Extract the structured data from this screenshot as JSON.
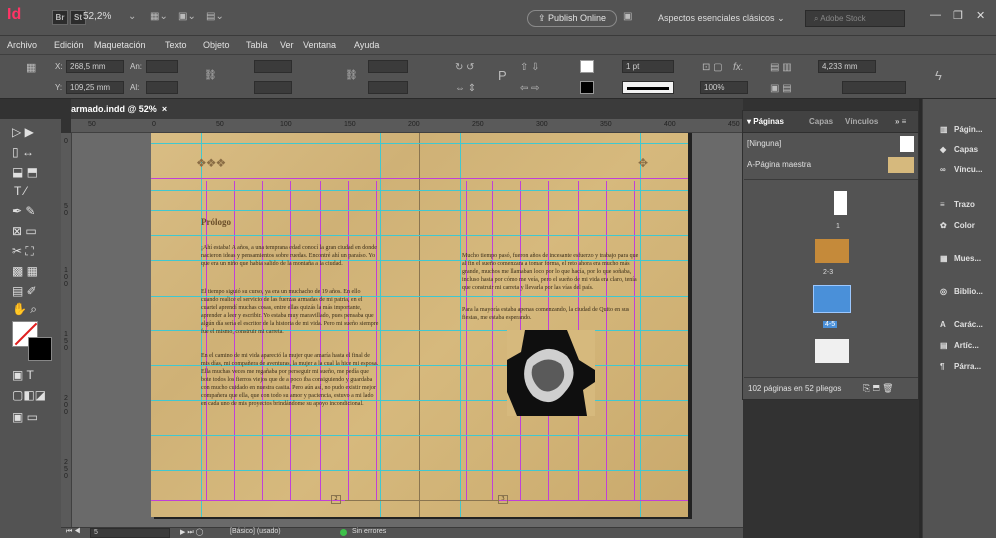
{
  "app": {
    "logo": "Id",
    "br": "Br",
    "st": "St",
    "zoom": "52,2%",
    "publish_label": "Publish Online",
    "workspace": "Aspectos esenciales clásicos",
    "stock_placeholder": "Adobe Stock"
  },
  "menu": [
    "Archivo",
    "Edición",
    "Maquetación",
    "Texto",
    "Objeto",
    "Tabla",
    "Ver",
    "Ventana",
    "Ayuda"
  ],
  "control": {
    "x_label": "X:",
    "x_value": "268,5 mm",
    "y_label": "Y:",
    "y_value": "109,25 mm",
    "w_label": "An:",
    "h_label": "Al:",
    "stroke_weight": "1 pt",
    "zoom_pct": "100%",
    "gap_value": "4,233 mm",
    "fx": "fx."
  },
  "document": {
    "tab_title": "armado.indd @ 52%",
    "close": "×"
  },
  "ruler": {
    "top": [
      "50",
      "0",
      "50",
      "100",
      "150",
      "200",
      "250",
      "300",
      "350",
      "400",
      "450"
    ],
    "left": [
      "0",
      "5\n0",
      "1\n0\n0",
      "1\n5\n0",
      "2\n0\n0",
      "2\n5\n0"
    ]
  },
  "page_left": {
    "title": "Prólogo",
    "p1": "¡Ahí estaba! A años, a una temprana edad conocí la gran ciudad en donde nacieron ideas y pensamientos sobre ruedas. Encontré ahí un paraíso. Yo que era un niño que había salido de la montaña a la ciudad.",
    "p2": "El tiempo siguió su curso, ya era un muchacho de 19 años. En ello cuando realicé el servicio de las fuerzas armadas de mi patria, en el cuartel aprendí muchas cosas, entre ellas quizás la más importante, aprender a leer y escribir. Yo estaba muy maravillado, pues pensaba que algún día sería el escritor de la historia de mi vida. Pero mi sueño siempre fue el mismo, construir mi carreta.",
    "p3": "En el camino de mi vida apareció la mujer que amaría hasta el final de mis días, mi compañera de aventuras, la mujer a la cual la hice mi esposa. Ella muchas veces me regañaba por perseguir mi sueño, me pedía que bote todos los fierros viejos que de a poco iba consiguiendo y guardaba con mucho cuidado en nuestra casita. Pero aún así, no pudo existir mejor compañera que ella, que con todo su amor y paciencia, estuvo a mi lado en cada uno de mis proyectos brindándome su apoyo incondicional.",
    "folio": "2"
  },
  "page_right": {
    "p1": "Mucho tiempo pasó, fueron años de incesante esfuerzo y trabajo para que al fin el sueño comenzara a tomar forma, el reto ahora era mucho más grande, muchos me llamaban loco por lo que hacía, por lo que soñaba, incluso hasta por cómo me veía, pero el sueño de mi vida era claro, tenía que construir mi carreta y llevarla por las vías del país.",
    "p2": "Para la mayoría estaba apenas comenzando, la ciudad de Quito en sus fiestas, me estaba esperando.",
    "folio": "3"
  },
  "status": {
    "page": "5",
    "style": "[Básico] (usado)",
    "errors": "Sin errores"
  },
  "pages_panel": {
    "tabs": [
      "Páginas",
      "Capas",
      "Vínculos"
    ],
    "none": "[Ninguna]",
    "master": "A-Página maestra",
    "thumb_labels": [
      "1",
      "2-3",
      "4-5"
    ],
    "footer": "102 páginas en 52 pliegos"
  },
  "panels": [
    "Págin...",
    "Capas",
    "Víncu...",
    "Trazo",
    "Color",
    "Mues...",
    "Biblio...",
    "Carác...",
    "Artíc...",
    "Párra..."
  ],
  "colors": {
    "accent": "#ff3366",
    "guide_margin": "#c040d8",
    "guide_column": "#40c8d0",
    "selected_page": "#4a90d9"
  }
}
